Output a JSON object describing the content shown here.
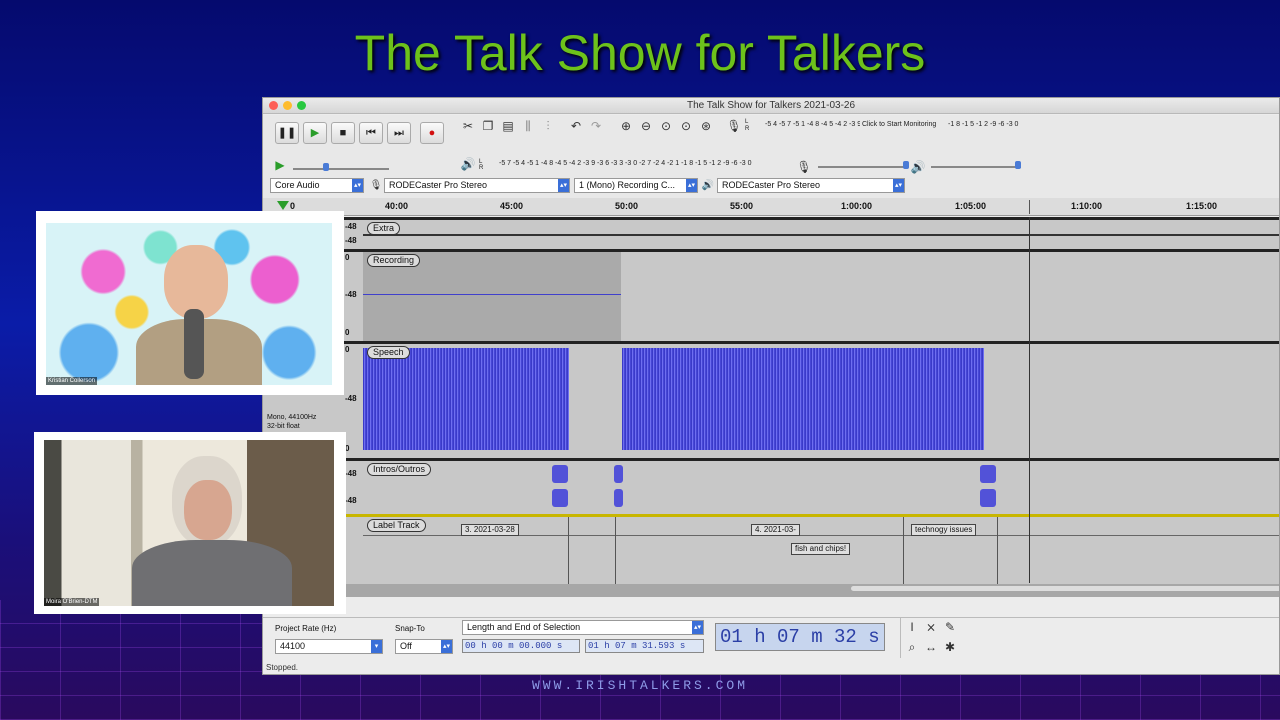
{
  "show_title": "The Talk Show for Talkers",
  "site": "WWW.IRISHTALKERS.COM",
  "window": {
    "title": "The Talk Show for Talkers 2021-03-26"
  },
  "meters": {
    "rec_scale": "-5 4 -5 7 -5 1 -4 8 -4 5 -4 2 -3 9 -3 6 -3 3",
    "rec_hint": "Click to Start Monitoring",
    "rec_scale_right": "-1 8 -1 5 -1 2 -9 -6 -3 0",
    "play_scale": "-5 7 -5 4 -5 1 -4 8 -4 5 -4 2 -3 9 -3 6 -3 3 -3 0 -2 7 -2 4 -2 1 -1 8 -1 5 -1 2 -9 -6 -3 0",
    "rec_l": "L",
    "rec_r": "R"
  },
  "devices": {
    "host": "Core Audio",
    "input": "RODECaster Pro Stereo",
    "channels": "1 (Mono) Recording C...",
    "output": "RODECaster Pro Stereo"
  },
  "ruler": {
    "ticks": [
      "0",
      "40:00",
      "45:00",
      "50:00",
      "55:00",
      "1:00:00",
      "1:05:00",
      "1:10:00",
      "1:15:00"
    ]
  },
  "tracks": [
    {
      "name": "Extra",
      "scale_top": "-48",
      "scale_bottom": "-48"
    },
    {
      "name": "Recording",
      "scale_top": "0",
      "scale_mid": "-48",
      "scale_bottom": "0"
    },
    {
      "name": "Speech",
      "scale_top": "0",
      "scale_mid": "-48",
      "scale_bottom": "0",
      "info1": "Mono, 44100Hz",
      "info2": "32-bit float"
    },
    {
      "name": "Intros/Outros",
      "scale_top": "-48",
      "scale_bottom": "-48"
    },
    {
      "name": "Label Track"
    }
  ],
  "labels": [
    "3. 2021-03-28",
    "4. 2021-03-",
    "fish and chips!",
    "technogy issues"
  ],
  "bottom": {
    "rate_label": "Project Rate (Hz)",
    "rate_value": "44100",
    "snap_label": "Snap-To",
    "snap_value": "Off",
    "selection_mode": "Length and End of Selection",
    "sel_start": "00 h 00 m 00.000 s",
    "sel_end": "01 h 07 m 31.593 s",
    "big_time": "01 h 07 m 32 s",
    "status": "Stopped."
  },
  "cams": {
    "top_name": "Kristian Collerson",
    "bottom_name": "Moira O'Brien-DTM"
  }
}
